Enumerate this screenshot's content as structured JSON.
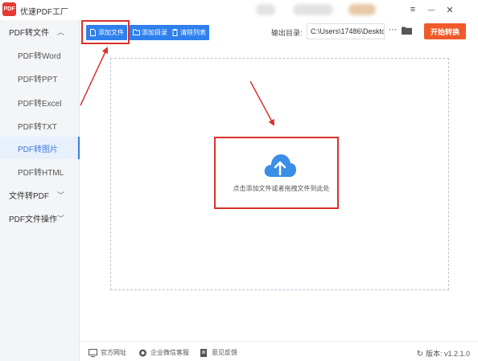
{
  "app": {
    "title": "优速PDF工厂",
    "logo_text": "PDF"
  },
  "window_controls": {
    "menu": "≡",
    "minimize": "—",
    "close": "✕"
  },
  "sidebar": {
    "groups": [
      {
        "label": "PDF转文件",
        "expanded": true,
        "items": [
          {
            "label": "PDF转Word",
            "active": false
          },
          {
            "label": "PDF转PPT",
            "active": false
          },
          {
            "label": "PDF转Excel",
            "active": false
          },
          {
            "label": "PDF转TXT",
            "active": false
          },
          {
            "label": "PDF转图片",
            "active": true
          },
          {
            "label": "PDF转HTML",
            "active": false
          }
        ]
      },
      {
        "label": "文件转PDF",
        "expanded": false,
        "items": []
      },
      {
        "label": "PDF文件操作",
        "expanded": false,
        "items": []
      }
    ]
  },
  "toolbar": {
    "add_file": "添加文件",
    "add_folder": "添加目录",
    "clear_list": "清除列表",
    "output_label": "输出目录:",
    "output_path": "C:\\Users\\17486\\Deskto",
    "more": "···",
    "start": "开始转换"
  },
  "dropzone": {
    "hint": "点击添加文件或者拖拽文件到此处"
  },
  "footer": {
    "website": "官方网址",
    "wechat": "企业微信客服",
    "feedback": "意见反馈",
    "version": "版本: v1.2.1.0"
  },
  "colors": {
    "primary": "#2f80ed",
    "start_button": "#f05a28",
    "annotation": "#d9312a",
    "upload_icon": "#3a8ee6"
  }
}
